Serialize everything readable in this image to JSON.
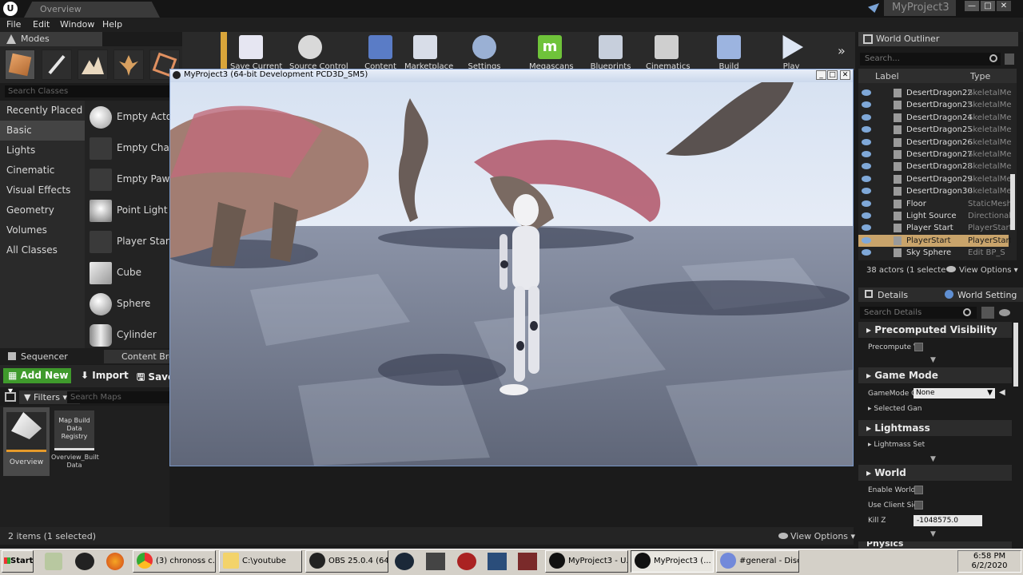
{
  "titlebar": {
    "doc_tab": "Overview",
    "project_name": "MyProject3",
    "controls": [
      "—",
      "□",
      "✕"
    ]
  },
  "menu": [
    "File",
    "Edit",
    "Window",
    "Help"
  ],
  "modes": {
    "title": "Modes",
    "search_placeholder": "Search Classes",
    "categories": [
      "Recently Placed",
      "Basic",
      "Lights",
      "Cinematic",
      "Visual Effects",
      "Geometry",
      "Volumes",
      "All Classes"
    ],
    "selected_category": "Basic",
    "placeables": [
      "Empty Actor",
      "Empty Chara",
      "Empty Pawn",
      "Point Light",
      "Player Start",
      "Cube",
      "Sphere",
      "Cylinder"
    ]
  },
  "toolbar": {
    "buttons": [
      "Save Current",
      "Source Control",
      "Content",
      "Marketplace",
      "Settings",
      "Megascans",
      "Blueprints",
      "Cinematics",
      "Build",
      "Play"
    ],
    "overflow": "»"
  },
  "viewport": {
    "title": "MyProject3 (64-bit Development PCD3D_SM5)",
    "controls": [
      "_",
      "□",
      "✕"
    ]
  },
  "outliner": {
    "title": "World Outliner",
    "search_placeholder": "Search...",
    "col_label": "Label",
    "col_type": "Type",
    "rows": [
      {
        "label": "DesertDragon22",
        "type": "SkeletalMe"
      },
      {
        "label": "DesertDragon23",
        "type": "SkeletalMe"
      },
      {
        "label": "DesertDragon24",
        "type": "SkeletalMe"
      },
      {
        "label": "DesertDragon25",
        "type": "SkeletalMe"
      },
      {
        "label": "DesertDragon26",
        "type": "SkeletalMe"
      },
      {
        "label": "DesertDragon27",
        "type": "SkeletalMe"
      },
      {
        "label": "DesertDragon28",
        "type": "SkeletalMe"
      },
      {
        "label": "DesertDragon29",
        "type": "SkeletalMe"
      },
      {
        "label": "DesertDragon30",
        "type": "SkeletalMe"
      },
      {
        "label": "Floor",
        "type": "StaticMesh"
      },
      {
        "label": "Light Source",
        "type": "Directional"
      },
      {
        "label": "Player Start",
        "type": "PlayerStart"
      },
      {
        "label": "PlayerStart",
        "type": "PlayerStart"
      },
      {
        "label": "Sky Sphere",
        "type": "Edit BP_S"
      }
    ],
    "selected_row": "PlayerStart",
    "actor_count": "38 actors (1 selecte",
    "view_options": "View Options"
  },
  "details": {
    "tab_details": "Details",
    "tab_world_settings": "World Setting",
    "search_placeholder": "Search Details",
    "sections": [
      {
        "title": "Precomputed Visibility",
        "props": [
          "Precompute V"
        ]
      },
      {
        "title": "Game Mode",
        "props": [
          "GameMode O",
          "Selected Gan"
        ]
      },
      {
        "title": "Lightmass",
        "props": [
          "Lightmass Set"
        ]
      },
      {
        "title": "World",
        "props": [
          "Enable World (",
          "Use Client Sid",
          "Kill Z"
        ]
      }
    ],
    "gamemode_value": "None",
    "killz_value": "-1048575.0",
    "next_section_partial": "Physics"
  },
  "content_browser": {
    "tab_sequencer": "Sequencer",
    "tab_content": "Content Brow",
    "add_new": "Add New",
    "import": "Import",
    "save": "Save",
    "filters": "Filters",
    "search_placeholder": "Search Maps",
    "assets": [
      {
        "name": "Overview",
        "thumb_text": ""
      },
      {
        "name": "Overview_Built\nData",
        "thumb_text": "Map Build\nData\nRegistry"
      }
    ],
    "status": "2 items (1 selected)",
    "view_options": "View Options"
  },
  "taskbar": {
    "start": "Start",
    "items": [
      "(3) chronoss c...",
      "C:\\youtube",
      "OBS 25.0.4 (64...",
      "MyProject3 - U...",
      "MyProject3 (...",
      "#general - Disc..."
    ],
    "time": "6:58 PM",
    "date": "6/2/2020"
  },
  "colors": {
    "accent_green": "#3f9a2c",
    "selection": "#c9a46b",
    "sky": "#dfe8f4",
    "floor": "#6e7688"
  }
}
